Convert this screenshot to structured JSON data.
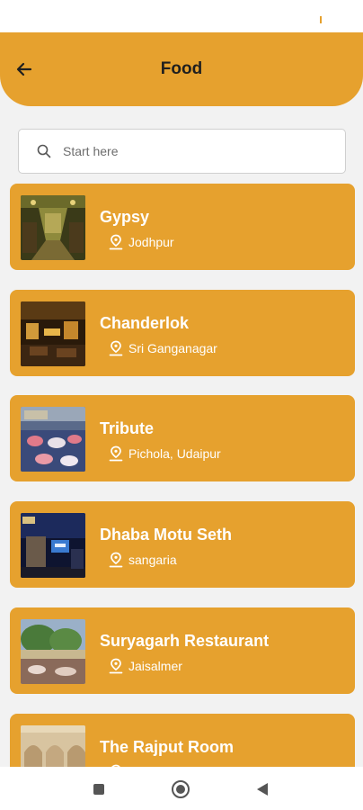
{
  "header": {
    "title": "Food",
    "back_icon": "arrow-left-icon"
  },
  "search": {
    "placeholder": "Start here",
    "icon": "search-icon"
  },
  "restaurants": [
    {
      "name": "Gypsy",
      "location": "Jodhpur"
    },
    {
      "name": "Chanderlok",
      "location": "Sri Ganganagar"
    },
    {
      "name": "Tribute",
      "location": "Pichola, Udaipur"
    },
    {
      "name": "Dhaba Motu Seth",
      "location": "sangaria"
    },
    {
      "name": "Suryagarh Restaurant",
      "location": "Jaisalmer"
    },
    {
      "name": "The Rajput Room",
      "location": ""
    }
  ],
  "theme": {
    "accent": "#e6a12e",
    "background": "#f2f2f2",
    "text_on_accent": "#ffffff"
  },
  "nav": {
    "icons": [
      "recents-square-icon",
      "home-circle-icon",
      "back-triangle-icon"
    ]
  }
}
